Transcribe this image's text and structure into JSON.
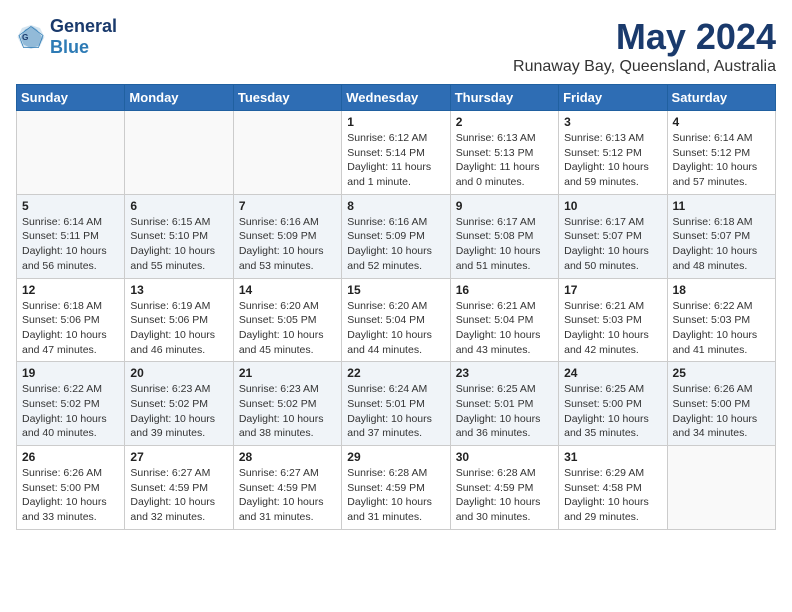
{
  "header": {
    "logo_general": "General",
    "logo_blue": "Blue",
    "month_title": "May 2024",
    "location": "Runaway Bay, Queensland, Australia"
  },
  "days_of_week": [
    "Sunday",
    "Monday",
    "Tuesday",
    "Wednesday",
    "Thursday",
    "Friday",
    "Saturday"
  ],
  "weeks": [
    [
      {
        "day": "",
        "info": ""
      },
      {
        "day": "",
        "info": ""
      },
      {
        "day": "",
        "info": ""
      },
      {
        "day": "1",
        "info": "Sunrise: 6:12 AM\nSunset: 5:14 PM\nDaylight: 11 hours\nand 1 minute."
      },
      {
        "day": "2",
        "info": "Sunrise: 6:13 AM\nSunset: 5:13 PM\nDaylight: 11 hours\nand 0 minutes."
      },
      {
        "day": "3",
        "info": "Sunrise: 6:13 AM\nSunset: 5:12 PM\nDaylight: 10 hours\nand 59 minutes."
      },
      {
        "day": "4",
        "info": "Sunrise: 6:14 AM\nSunset: 5:12 PM\nDaylight: 10 hours\nand 57 minutes."
      }
    ],
    [
      {
        "day": "5",
        "info": "Sunrise: 6:14 AM\nSunset: 5:11 PM\nDaylight: 10 hours\nand 56 minutes."
      },
      {
        "day": "6",
        "info": "Sunrise: 6:15 AM\nSunset: 5:10 PM\nDaylight: 10 hours\nand 55 minutes."
      },
      {
        "day": "7",
        "info": "Sunrise: 6:16 AM\nSunset: 5:09 PM\nDaylight: 10 hours\nand 53 minutes."
      },
      {
        "day": "8",
        "info": "Sunrise: 6:16 AM\nSunset: 5:09 PM\nDaylight: 10 hours\nand 52 minutes."
      },
      {
        "day": "9",
        "info": "Sunrise: 6:17 AM\nSunset: 5:08 PM\nDaylight: 10 hours\nand 51 minutes."
      },
      {
        "day": "10",
        "info": "Sunrise: 6:17 AM\nSunset: 5:07 PM\nDaylight: 10 hours\nand 50 minutes."
      },
      {
        "day": "11",
        "info": "Sunrise: 6:18 AM\nSunset: 5:07 PM\nDaylight: 10 hours\nand 48 minutes."
      }
    ],
    [
      {
        "day": "12",
        "info": "Sunrise: 6:18 AM\nSunset: 5:06 PM\nDaylight: 10 hours\nand 47 minutes."
      },
      {
        "day": "13",
        "info": "Sunrise: 6:19 AM\nSunset: 5:06 PM\nDaylight: 10 hours\nand 46 minutes."
      },
      {
        "day": "14",
        "info": "Sunrise: 6:20 AM\nSunset: 5:05 PM\nDaylight: 10 hours\nand 45 minutes."
      },
      {
        "day": "15",
        "info": "Sunrise: 6:20 AM\nSunset: 5:04 PM\nDaylight: 10 hours\nand 44 minutes."
      },
      {
        "day": "16",
        "info": "Sunrise: 6:21 AM\nSunset: 5:04 PM\nDaylight: 10 hours\nand 43 minutes."
      },
      {
        "day": "17",
        "info": "Sunrise: 6:21 AM\nSunset: 5:03 PM\nDaylight: 10 hours\nand 42 minutes."
      },
      {
        "day": "18",
        "info": "Sunrise: 6:22 AM\nSunset: 5:03 PM\nDaylight: 10 hours\nand 41 minutes."
      }
    ],
    [
      {
        "day": "19",
        "info": "Sunrise: 6:22 AM\nSunset: 5:02 PM\nDaylight: 10 hours\nand 40 minutes."
      },
      {
        "day": "20",
        "info": "Sunrise: 6:23 AM\nSunset: 5:02 PM\nDaylight: 10 hours\nand 39 minutes."
      },
      {
        "day": "21",
        "info": "Sunrise: 6:23 AM\nSunset: 5:02 PM\nDaylight: 10 hours\nand 38 minutes."
      },
      {
        "day": "22",
        "info": "Sunrise: 6:24 AM\nSunset: 5:01 PM\nDaylight: 10 hours\nand 37 minutes."
      },
      {
        "day": "23",
        "info": "Sunrise: 6:25 AM\nSunset: 5:01 PM\nDaylight: 10 hours\nand 36 minutes."
      },
      {
        "day": "24",
        "info": "Sunrise: 6:25 AM\nSunset: 5:00 PM\nDaylight: 10 hours\nand 35 minutes."
      },
      {
        "day": "25",
        "info": "Sunrise: 6:26 AM\nSunset: 5:00 PM\nDaylight: 10 hours\nand 34 minutes."
      }
    ],
    [
      {
        "day": "26",
        "info": "Sunrise: 6:26 AM\nSunset: 5:00 PM\nDaylight: 10 hours\nand 33 minutes."
      },
      {
        "day": "27",
        "info": "Sunrise: 6:27 AM\nSunset: 4:59 PM\nDaylight: 10 hours\nand 32 minutes."
      },
      {
        "day": "28",
        "info": "Sunrise: 6:27 AM\nSunset: 4:59 PM\nDaylight: 10 hours\nand 31 minutes."
      },
      {
        "day": "29",
        "info": "Sunrise: 6:28 AM\nSunset: 4:59 PM\nDaylight: 10 hours\nand 31 minutes."
      },
      {
        "day": "30",
        "info": "Sunrise: 6:28 AM\nSunset: 4:59 PM\nDaylight: 10 hours\nand 30 minutes."
      },
      {
        "day": "31",
        "info": "Sunrise: 6:29 AM\nSunset: 4:58 PM\nDaylight: 10 hours\nand 29 minutes."
      },
      {
        "day": "",
        "info": ""
      }
    ]
  ]
}
